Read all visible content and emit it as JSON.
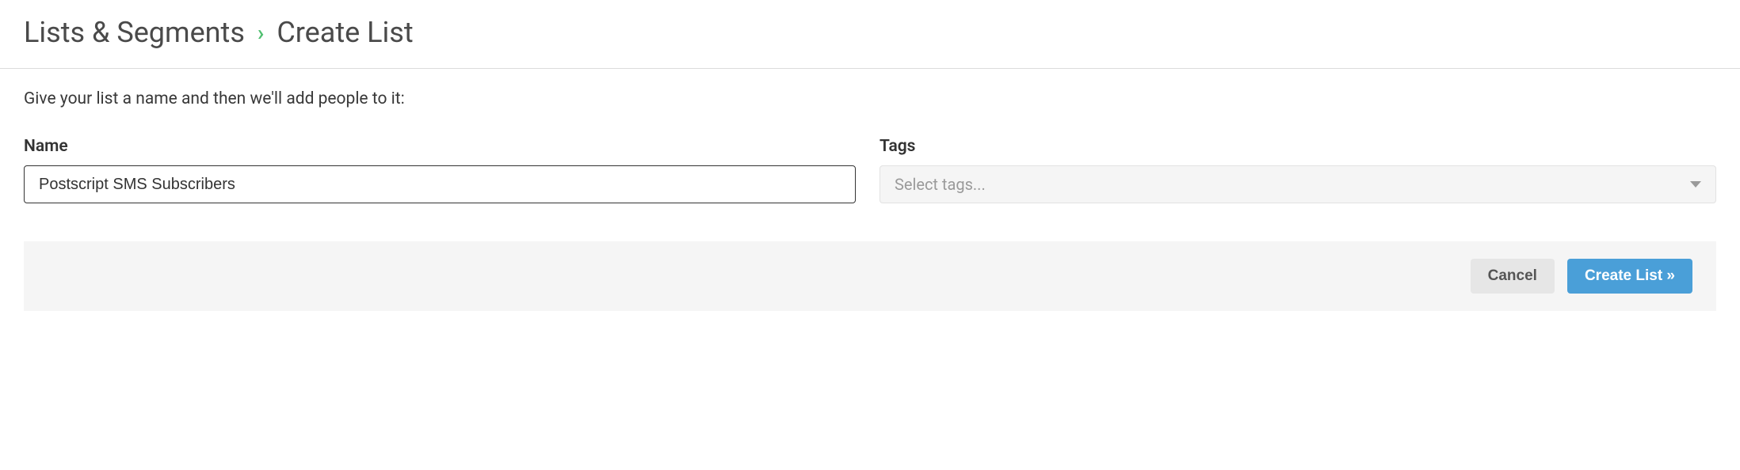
{
  "breadcrumb": {
    "parent": "Lists & Segments",
    "separator": "›",
    "current": "Create List"
  },
  "instruction": "Give your list a name and then we'll add people to it:",
  "form": {
    "name": {
      "label": "Name",
      "value": "Postscript SMS Subscribers"
    },
    "tags": {
      "label": "Tags",
      "placeholder": "Select tags..."
    }
  },
  "actions": {
    "cancel": "Cancel",
    "create": "Create List »"
  }
}
